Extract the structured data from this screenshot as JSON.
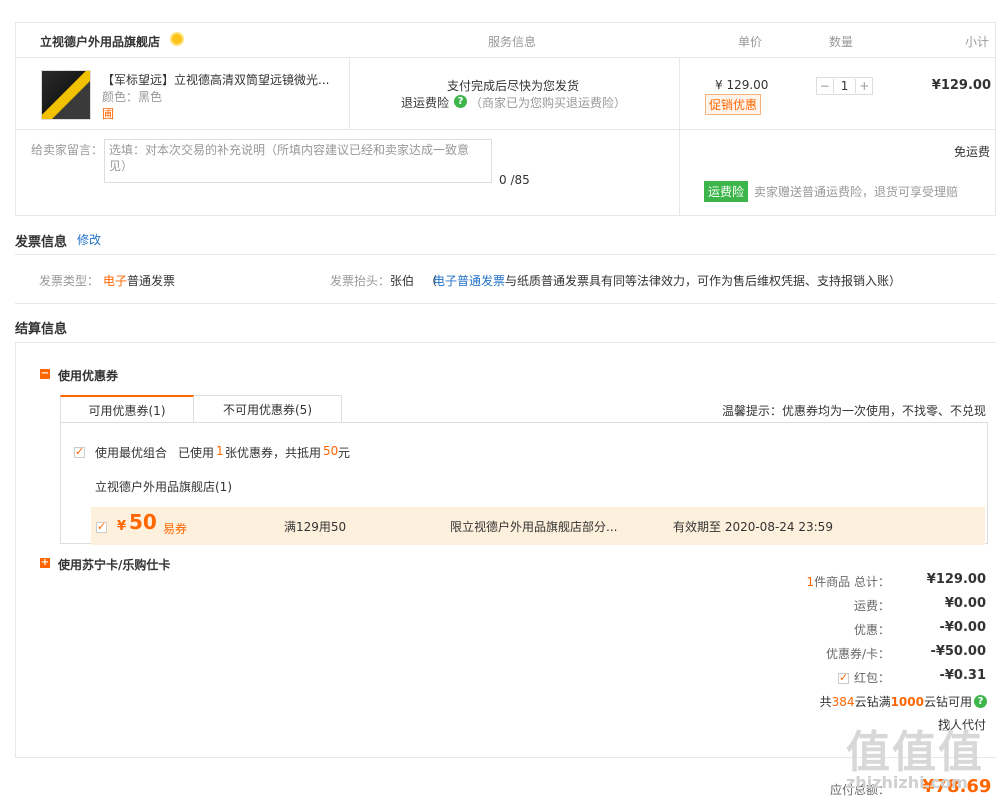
{
  "order": {
    "store_name": "立视德户外用品旗舰店",
    "col_service": "服务信息",
    "col_price": "单价",
    "col_qty": "数量",
    "col_subtotal": "小计",
    "product": {
      "title": "【军标望远】立视德高清双筒望远镜微光...",
      "color": "颜色：黑色",
      "extra": "圃",
      "service_line1": "支付完成后尽快为您发货",
      "service_return": "退运费险",
      "service_return_note": "（商家已为您购买退运费险）",
      "price": "¥ 129.00",
      "promo_tag": "促销优惠",
      "qty_minus": "−",
      "qty": "1",
      "qty_plus": "+",
      "subtotal": "¥129.00"
    },
    "memo_label": "给卖家留言：",
    "memo_placeholder": "选填：对本次交易的补充说明（所填内容建议已经和卖家达成一致意见）",
    "memo_count": "0 /85",
    "shipping": "免运费",
    "freight_tag": "运费险",
    "freight_note": "卖家赠送普通运费险，退货可享受理赔"
  },
  "invoice": {
    "title": "发票信息",
    "edit": "修改",
    "type_label": "发票类型：",
    "type_value_highlight": "电子",
    "type_value_rest": "普通发票",
    "header_label": "发票抬头：",
    "header_value": "张伯",
    "note_open": "（",
    "note_link": "电子普通发票",
    "note_rest": "与纸质普通发票具有同等法律效力，可作为售后维权凭据、支持报销入账）"
  },
  "settlement": {
    "title": "结算信息",
    "coupon_section": "使用优惠券",
    "tab_available": "可用优惠券(1)",
    "tab_unavailable": "不可用优惠券(5)",
    "tip": "温馨提示：优惠券均为一次使用，不找零、不兑现",
    "best_combo": "使用最优组合",
    "used_prefix": "已使用",
    "used_count": "1",
    "used_mid": "张优惠券，共抵用",
    "used_amount": "50",
    "used_suffix": "元",
    "store_group": "立视德户外用品旗舰店(1)",
    "coupon": {
      "currency": "¥",
      "amount": "50",
      "type": "易券",
      "rule": "满129用50",
      "scope": "限立视德户外用品旗舰店部分...",
      "expiry": "有效期至 2020-08-24 23:59"
    },
    "card_section": "使用苏宁卡/乐购仕卡",
    "summary": {
      "count_prefix": "1",
      "count_label": "件商品 总计：",
      "total": "¥129.00",
      "shipping_label": "运费：",
      "shipping": "¥0.00",
      "discount_label": "优惠：",
      "discount": "-¥0.00",
      "coupon_label": "优惠券/卡：",
      "coupon": "-¥50.00",
      "redpacket_label": "红包：",
      "redpacket": "-¥0.31",
      "diamond_prefix": "共",
      "diamond_count": "384",
      "diamond_mid": "云钻满",
      "diamond_threshold": "1000",
      "diamond_suffix": "云钻可用",
      "proxy_pay": "找人代付",
      "payable_label": "应付总额：",
      "payable": "¥78.69"
    }
  },
  "watermark": {
    "logo": "值值值",
    "domain": "zhizhizhi.com"
  },
  "colors": {
    "accent": "#ff6600",
    "link": "#2272c8",
    "green": "#3cb54a",
    "coupon_bg": "#fdf0dd"
  }
}
